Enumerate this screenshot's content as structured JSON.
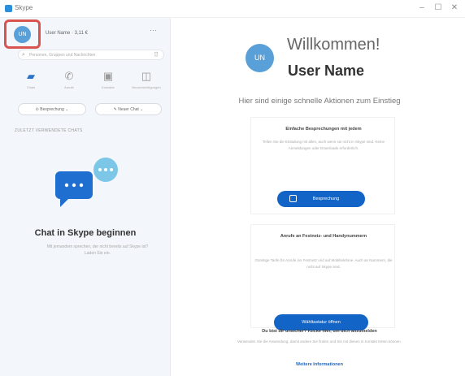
{
  "window": {
    "title": "Skype",
    "minimize_glyph": "–",
    "maximize_glyph": "☐",
    "close_glyph": "✕"
  },
  "sidebar": {
    "profile": {
      "initials": "UN",
      "name": "User Name · 3,11 €",
      "more": "···"
    },
    "search": {
      "placeholder": "Personen, Gruppen und Nachrichten"
    },
    "nav": [
      {
        "label": "Chats",
        "icon": "chat-icon"
      },
      {
        "label": "Anrufe",
        "icon": "phone-icon"
      },
      {
        "label": "Kontakte",
        "icon": "contacts-icon"
      },
      {
        "label": "Benachrichtigungen",
        "icon": "bell-icon"
      }
    ],
    "meet_now": "Besprechung",
    "new_chat": "Neuer Chat",
    "recent_label": "ZULETZT VERWENDETE CHATS",
    "empty_title": "Chat in Skype beginnen",
    "empty_subtitle": "Mit jemandem sprechen, der nicht bereits auf Skype ist? Laden Sie ein."
  },
  "main": {
    "avatar_initials": "UN",
    "welcome": "Willkommen!",
    "user_name": "User Name",
    "intro": "Hier sind einige schnelle Aktionen zum Einstieg",
    "card1": {
      "title": "Einfache Besprechungen mit jedem",
      "body": "Teilen Sie die Einladung mit allen, auch wenn sie nicht in Skype sind. Keine Anmeldungen oder Downloads erforderlich.",
      "button": "Besprechung"
    },
    "card2": {
      "title": "Anrufe an Festnetz- und Handynummern",
      "body": "Günstige Tarife für Anrufe ins Festnetz und auf Mobiltelefone. Auch an Nummern, die nicht auf Skype sind.",
      "button": "Wähltastatur öffnen"
    },
    "question": "Du bist dir unsicher? Klicke hier, um dich anzumelden",
    "question_sub": "Verwenden Sie die Anwendung, damit andere Sie finden und Sie mit diesen in Kontakt treten können.",
    "more_info": "Weitere Informationen"
  },
  "colors": {
    "accent": "#1264c6",
    "highlight_outline": "#d9534f",
    "sidebar_bg": "#f3f6fa"
  }
}
